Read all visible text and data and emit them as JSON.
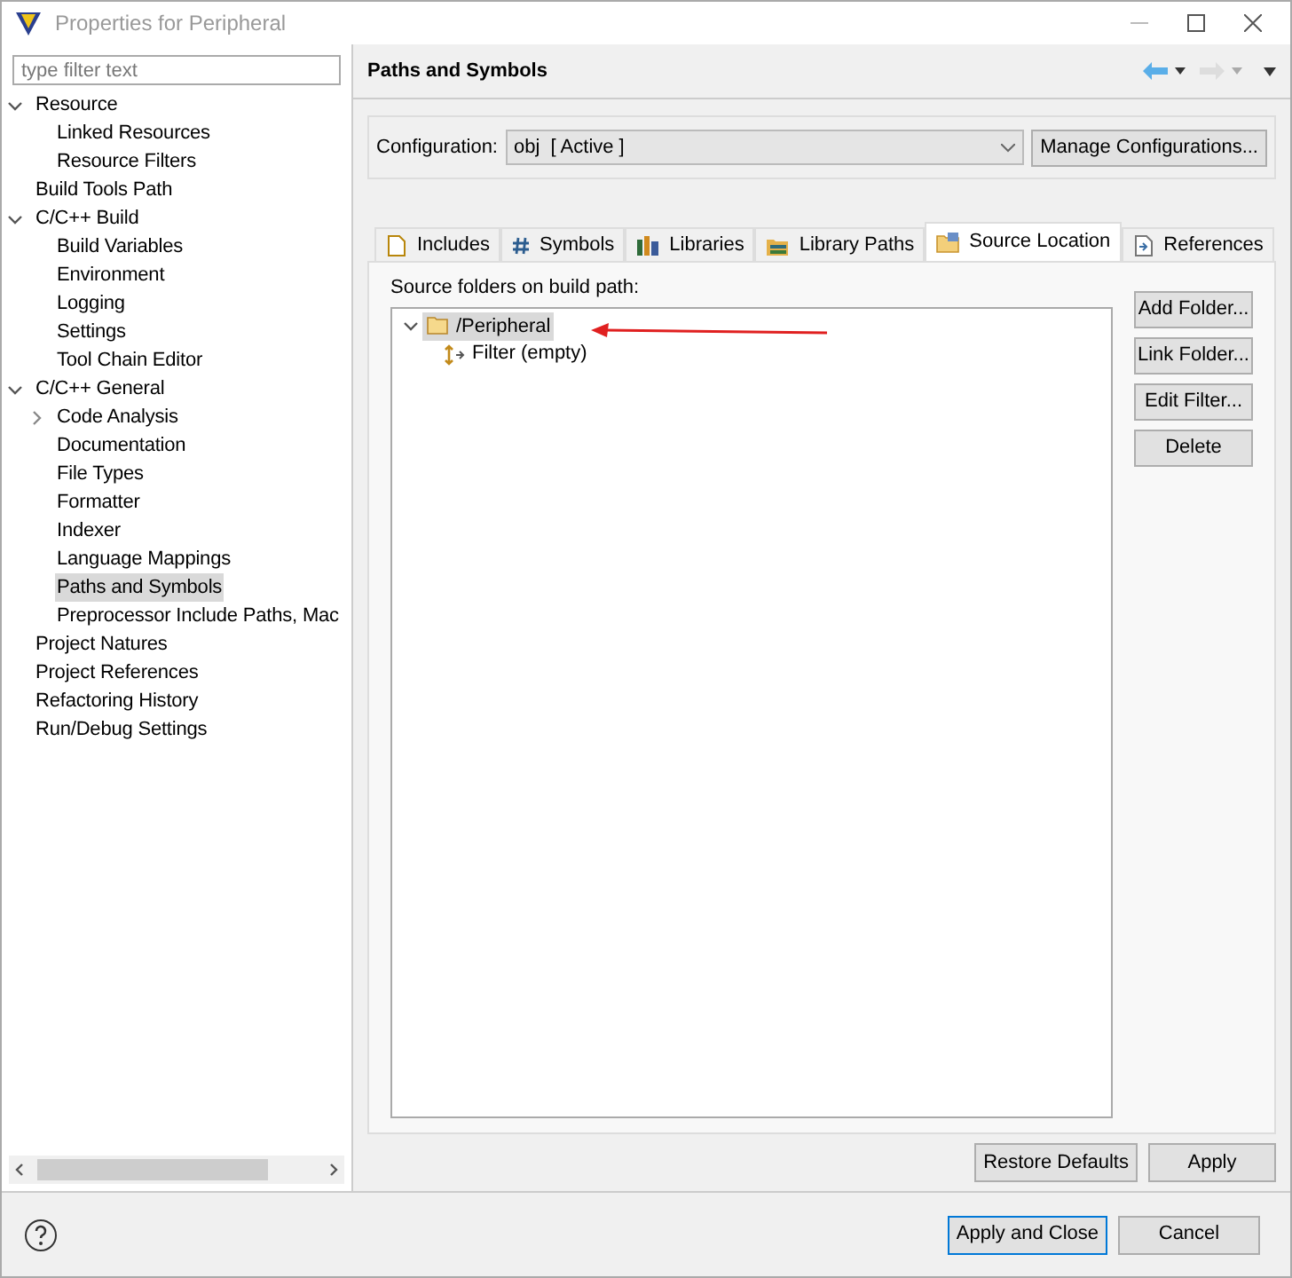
{
  "window": {
    "title": "Properties for Peripheral"
  },
  "filter": {
    "placeholder": "type filter text"
  },
  "nav_tree": [
    {
      "label": "Resource",
      "expanded": true,
      "selected": false,
      "children": [
        {
          "label": "Linked Resources",
          "selected": false
        },
        {
          "label": "Resource Filters",
          "selected": false
        }
      ]
    },
    {
      "label": "Build Tools Path",
      "selected": false
    },
    {
      "label": "C/C++ Build",
      "expanded": true,
      "selected": false,
      "children": [
        {
          "label": "Build Variables",
          "selected": false
        },
        {
          "label": "Environment",
          "selected": false
        },
        {
          "label": "Logging",
          "selected": false
        },
        {
          "label": "Settings",
          "selected": false
        },
        {
          "label": "Tool Chain Editor",
          "selected": false
        }
      ]
    },
    {
      "label": "C/C++ General",
      "expanded": true,
      "selected": false,
      "children": [
        {
          "label": "Code Analysis",
          "expanded": false,
          "selected": false
        },
        {
          "label": "Documentation",
          "selected": false
        },
        {
          "label": "File Types",
          "selected": false
        },
        {
          "label": "Formatter",
          "selected": false
        },
        {
          "label": "Indexer",
          "selected": false
        },
        {
          "label": "Language Mappings",
          "selected": false
        },
        {
          "label": "Paths and Symbols",
          "selected": true
        },
        {
          "label": "Preprocessor Include Paths, Mac",
          "selected": false
        }
      ]
    },
    {
      "label": "Project Natures",
      "selected": false
    },
    {
      "label": "Project References",
      "selected": false
    },
    {
      "label": "Refactoring History",
      "selected": false
    },
    {
      "label": "Run/Debug Settings",
      "selected": false
    }
  ],
  "page": {
    "title": "Paths and Symbols"
  },
  "configuration": {
    "label": "Configuration:",
    "value": "obj  [ Active ]",
    "button": "Manage Configurations..."
  },
  "tabs": [
    {
      "label": "Includes",
      "selected": false
    },
    {
      "label": "Symbols",
      "selected": false
    },
    {
      "label": "Libraries",
      "selected": false
    },
    {
      "label": "Library Paths",
      "selected": false
    },
    {
      "label": "Source Location",
      "selected": true
    },
    {
      "label": "References",
      "selected": false
    }
  ],
  "source_folders": {
    "label": "Source folders on build path:",
    "items": [
      {
        "label": "/Peripheral",
        "expanded": true,
        "selected": true,
        "children": [
          {
            "label": "Filter (empty)",
            "selected": false
          }
        ]
      }
    ]
  },
  "side_buttons": [
    "Add Folder...",
    "Link Folder...",
    "Edit Filter...",
    "Delete"
  ],
  "page_buttons": [
    "Restore Defaults",
    "Apply"
  ],
  "dialog_buttons": [
    {
      "label": "Apply and Close",
      "default": true
    },
    {
      "label": "Cancel",
      "default": false
    }
  ]
}
